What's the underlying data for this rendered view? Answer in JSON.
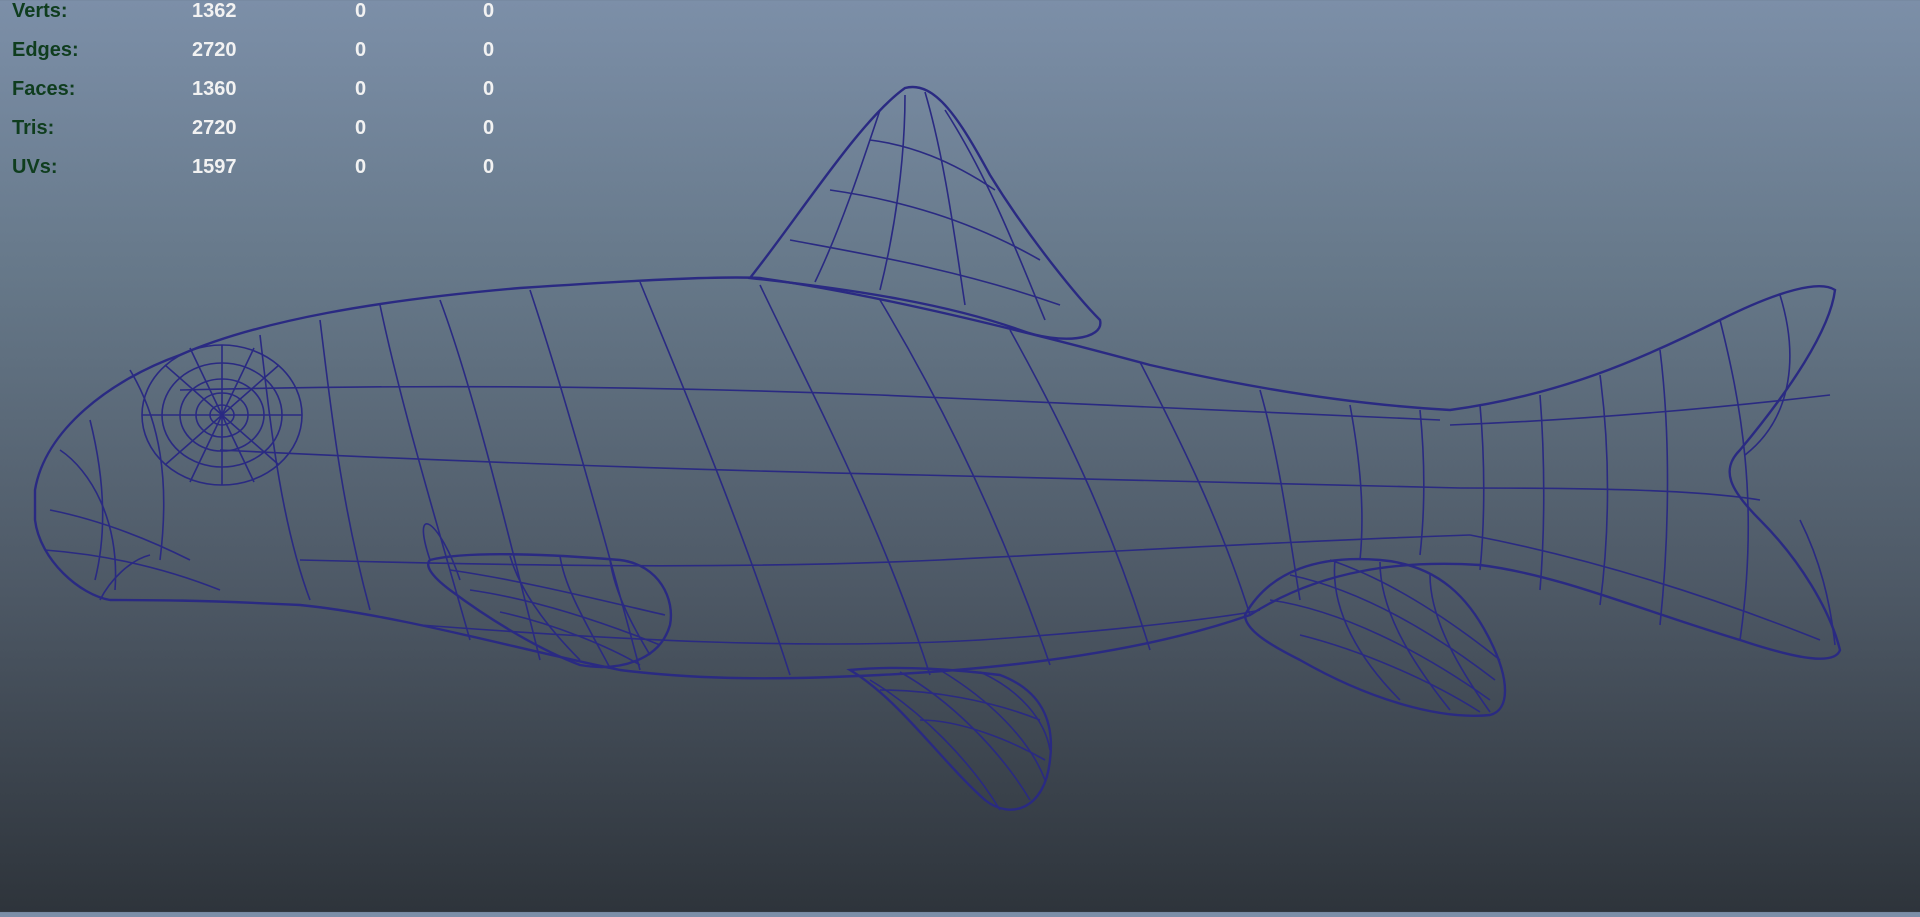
{
  "viewport": {
    "background_top": "#7c8fa8",
    "background_bottom": "#2e343b",
    "wireframe_color": "#2a2a82",
    "shade_color": "#858585"
  },
  "heads_up_display": {
    "label_color": "#0f3d1e",
    "value_color": "#f2f2f2",
    "rows": [
      {
        "label": "Verts:",
        "values": [
          "1362",
          "0",
          "0"
        ]
      },
      {
        "label": "Edges:",
        "values": [
          "2720",
          "0",
          "0"
        ]
      },
      {
        "label": "Faces:",
        "values": [
          "1360",
          "0",
          "0"
        ]
      },
      {
        "label": "Tris:",
        "values": [
          "2720",
          "0",
          "0"
        ]
      },
      {
        "label": "UVs:",
        "values": [
          "1597",
          "0",
          "0"
        ]
      }
    ]
  }
}
